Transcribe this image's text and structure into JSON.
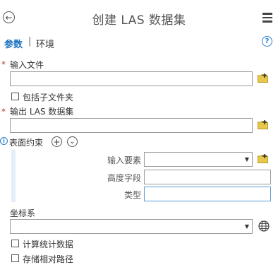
{
  "header": {
    "title": "创建 LAS 数据集",
    "back_icon": "back-arrow-icon",
    "menu_icon": "hamburger-menu-icon"
  },
  "tabs": {
    "params": "参数",
    "separator": "|",
    "env": "环境"
  },
  "help": {
    "label": "?"
  },
  "fields": {
    "input_files": {
      "required": "*",
      "label": "输入文件",
      "value": ""
    },
    "include_subfolders": {
      "label": "包括子文件夹",
      "checked": false
    },
    "output_las": {
      "required": "*",
      "label": "输出 LAS 数据集",
      "value": ""
    },
    "surface_constraints": {
      "info": "i",
      "label": "表面约束",
      "add": "+",
      "expand": "⌄",
      "rows": [
        {
          "label": "输入要素",
          "value": ""
        },
        {
          "label": "高度字段",
          "value": ""
        },
        {
          "label": "类型",
          "value": ""
        }
      ]
    },
    "coordinate_system": {
      "label": "坐标系",
      "value": ""
    },
    "compute_stats": {
      "label": "计算统计数据",
      "checked": false
    },
    "store_relative_paths": {
      "label": "存储相对路径",
      "checked": false
    }
  },
  "colors": {
    "accent": "#1a70c0",
    "required": "#c0392b",
    "folder": "#e8c84a"
  }
}
